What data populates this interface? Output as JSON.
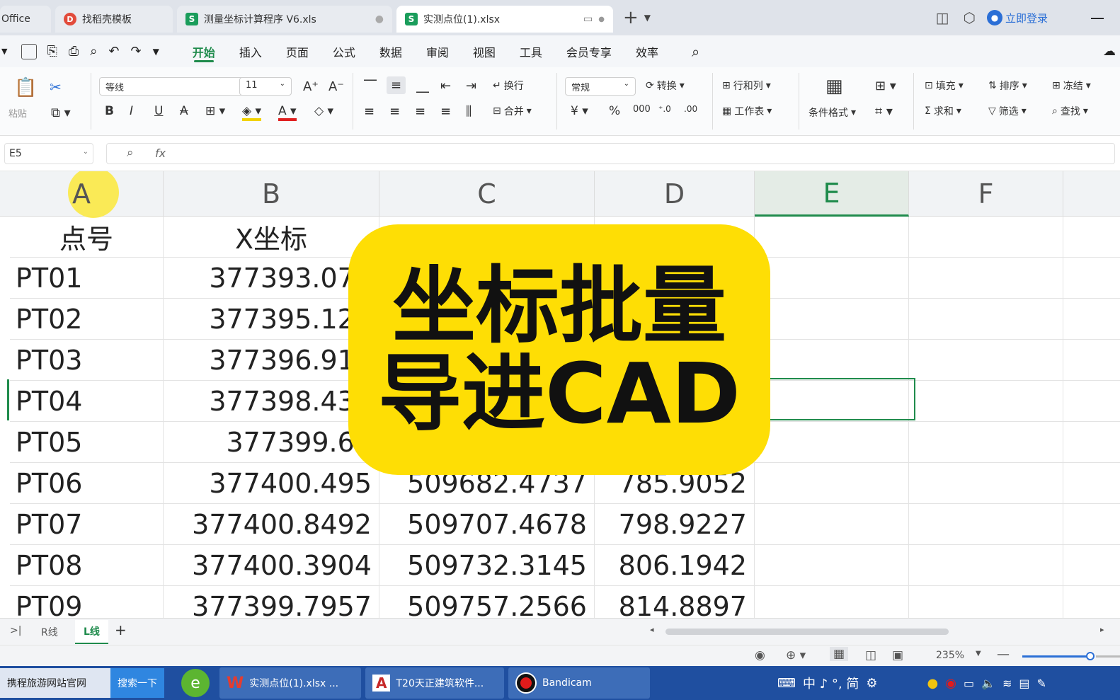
{
  "tabs": {
    "office": "Office",
    "t1": "找稻壳模板",
    "t2": "测量坐标计算程序 V6.xls",
    "t3": "实测点位(1).xlsx",
    "login": "立即登录"
  },
  "menu": [
    "开始",
    "插入",
    "页面",
    "公式",
    "数据",
    "审阅",
    "视图",
    "工具",
    "会员专享",
    "效率"
  ],
  "ribbon": {
    "paste": "粘贴",
    "font": "等线",
    "size": "11",
    "wrap": "换行",
    "merge": "合并",
    "format": "常规",
    "convert": "转换",
    "rowcol": "行和列",
    "sheet": "工作表",
    "cond": "条件格式",
    "fill": "填充",
    "sort": "排序",
    "freeze": "冻结",
    "sum": "求和",
    "filter": "筛选",
    "find": "查找"
  },
  "formula": {
    "cell_ref": "E5",
    "fx": "fx"
  },
  "columns": [
    "A",
    "B",
    "C",
    "D",
    "E",
    "F"
  ],
  "header_row": [
    "点号",
    "X坐标"
  ],
  "rows": [
    {
      "a": "PT01",
      "b": "377393.071",
      "c": "",
      "d": ""
    },
    {
      "a": "PT02",
      "b": "377395.123",
      "c": "",
      "d": ""
    },
    {
      "a": "PT03",
      "b": "377396.916",
      "c": "",
      "d": ""
    },
    {
      "a": "PT04",
      "b": "377398.430",
      "c": "",
      "d": ""
    },
    {
      "a": "PT05",
      "b": "377399.63",
      "c": "",
      "d": ""
    },
    {
      "a": "PT06",
      "b": "377400.495",
      "c": "509682.4737",
      "d": "785.9052"
    },
    {
      "a": "PT07",
      "b": "377400.8492",
      "c": "509707.4678",
      "d": "798.9227"
    },
    {
      "a": "PT08",
      "b": "377400.3904",
      "c": "509732.3145",
      "d": "806.1942"
    },
    {
      "a": "PT09",
      "b": "377399.7957",
      "c": "509757.2566",
      "d": "814.8897"
    }
  ],
  "overlay": {
    "line1": "坐标批量",
    "line2": "导进CAD"
  },
  "sheets": [
    "R线",
    "L线"
  ],
  "status": {
    "zoom": "235%"
  },
  "taskbar": {
    "item1": "携程旅游网站官网",
    "search": "搜索一下",
    "item2": "实测点位(1).xlsx ...",
    "item3": "T20天正建筑软件...",
    "item4": "Bandicam",
    "tray": "中 ♪ °, 简"
  },
  "colors": {
    "accent": "#1f8b4c",
    "overlay": "#fede05"
  }
}
